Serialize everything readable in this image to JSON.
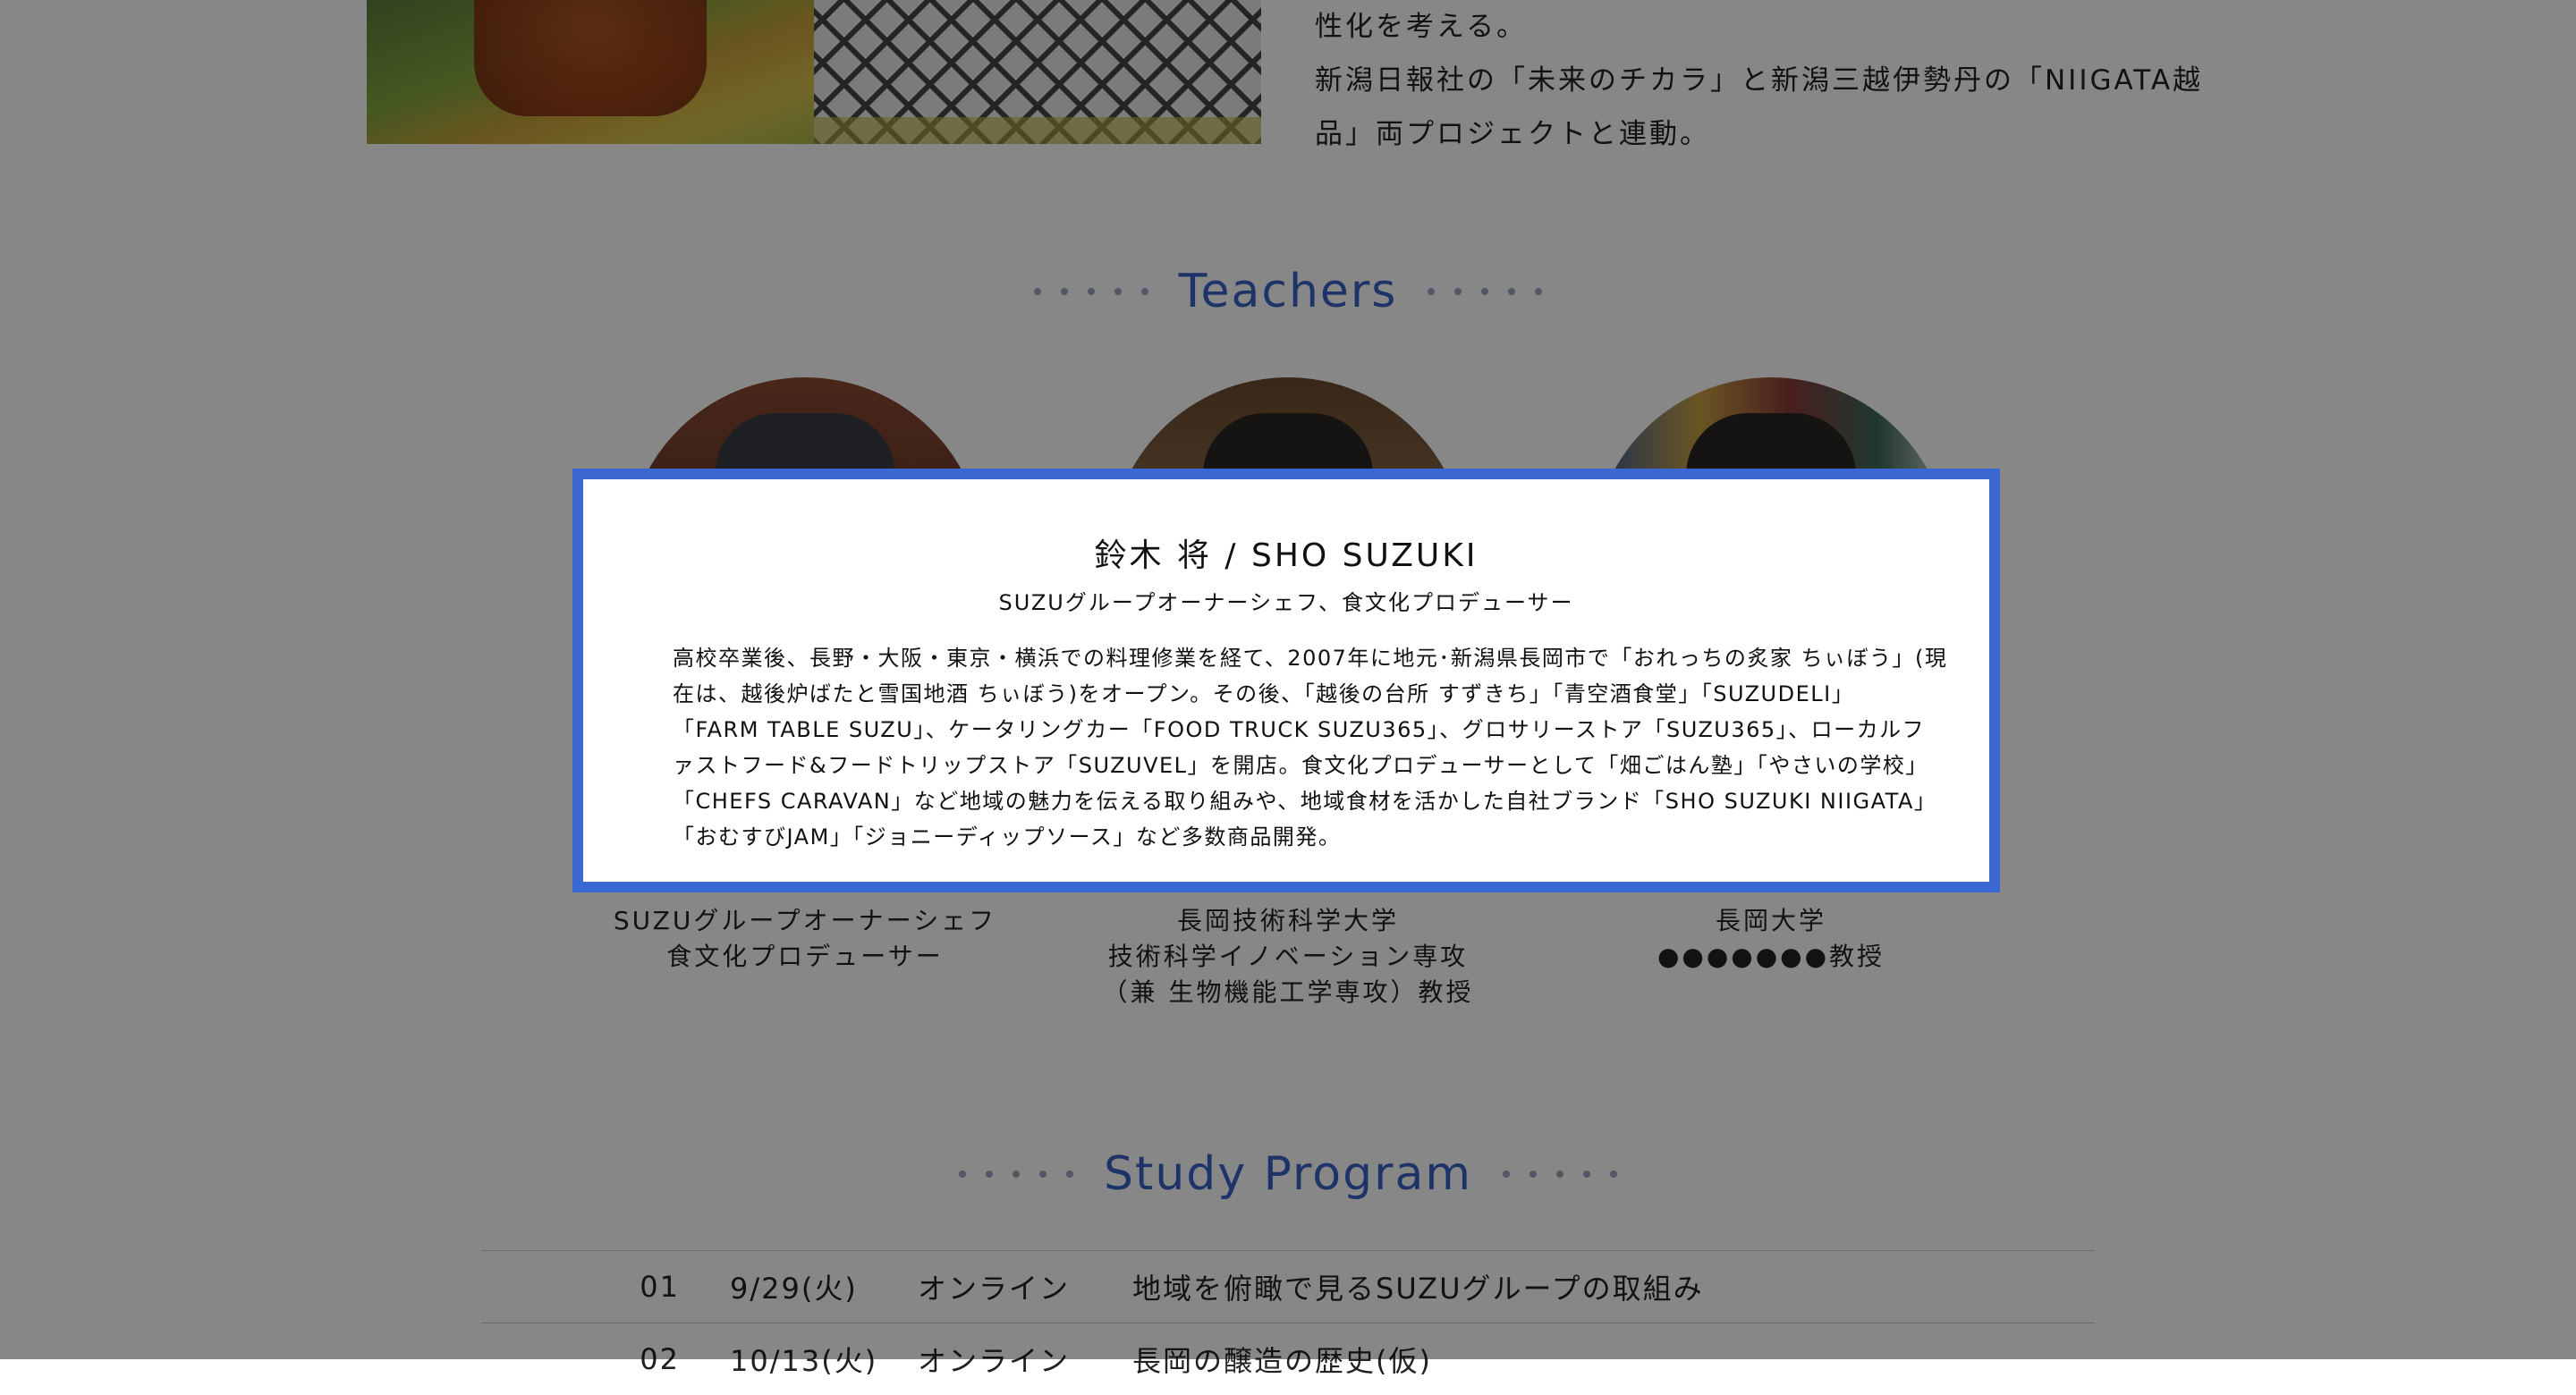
{
  "intro": {
    "lines": [
      "性化を考える。",
      "新潟日報社の「未来のチカラ」と新潟三越伊勢丹の「NIIGATA越",
      "品」両プロジェクトと連動。"
    ]
  },
  "teachers_section": {
    "title": "Teachers"
  },
  "teachers": [
    {
      "role_lines": [
        "SUZUグループオーナーシェフ",
        "食文化プロデューサー"
      ]
    },
    {
      "role_lines": [
        "長岡技術科学大学",
        "技術科学イノベーション専攻",
        "（兼 生物機能工学専攻）教授"
      ]
    },
    {
      "role_lines": [
        "長岡大学",
        "●●●●●●●教授"
      ]
    }
  ],
  "modal": {
    "name": "鈴木 将 / SHO SUZUKI",
    "role": "SUZUグループオーナーシェフ、食文化プロデューサー",
    "bio_lines": [
      "高校卒業後、長野・大阪・東京・横浜での料理修業を経て、2007年に地元･新潟県長岡市で「おれっちの炙家 ちぃぼう」(現",
      "在は、越後炉ばたと雪国地酒 ちぃぼう)をオープン。その後、「越後の台所 すずきち」「青空酒食堂」「SUZUDELI」",
      "「FARM TABLE SUZU」、ケータリングカー「FOOD TRUCK SUZU365」、グロサリーストア「SUZU365」、ローカルフ",
      "ァストフード&フードトリップストア「SUZUVEL」を開店。食文化プロデューサーとして「畑ごはん塾」「やさいの学校」",
      "「CHEFS CARAVAN」など地域の魅力を伝える取り組みや、地域食材を活かした自社ブランド「SHO SUZUKI NIIGATA」",
      "「おむすびJAM」「ジョニーディップソース」など多数商品開発。"
    ]
  },
  "program_section": {
    "title": "Study Program"
  },
  "program": [
    {
      "num": "01",
      "date": "9/29(火)",
      "mode": "オンライン",
      "topic": "地域を俯瞰で見るSUZUグループの取組み"
    },
    {
      "num": "02",
      "date": "10/13(火)",
      "mode": "オンライン",
      "topic": "長岡の醸造の歴史(仮)"
    }
  ],
  "colors": {
    "accent": "#3a67d2",
    "heading": "#3a62c4",
    "overlay": "rgba(0,0,0,0.47)"
  }
}
